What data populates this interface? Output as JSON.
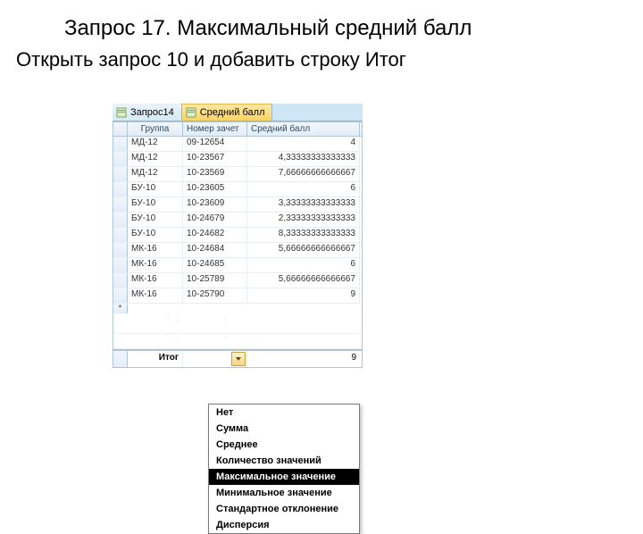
{
  "heading": "Запрос 17. Максимальный средний балл",
  "subheading": "Открыть запрос 10 и добавить строку Итог",
  "tabs": {
    "items": [
      {
        "label": "Запрос14",
        "icon": "query-icon"
      },
      {
        "label": "Средний балл",
        "icon": "query-icon"
      }
    ],
    "active_index": 1
  },
  "grid": {
    "columns": {
      "group": "Группа",
      "record_no": "Номер зачет",
      "avg": "Средний балл"
    },
    "rows": [
      {
        "group": "МД-12",
        "record_no": "09-12654",
        "avg": "4"
      },
      {
        "group": "МД-12",
        "record_no": "10-23567",
        "avg": "4,33333333333333"
      },
      {
        "group": "МД-12",
        "record_no": "10-23569",
        "avg": "7,66666666666667"
      },
      {
        "group": "БУ-10",
        "record_no": "10-23605",
        "avg": "6"
      },
      {
        "group": "БУ-10",
        "record_no": "10-23609",
        "avg": "3,33333333333333"
      },
      {
        "group": "БУ-10",
        "record_no": "10-24679",
        "avg": "2,33333333333333"
      },
      {
        "group": "БУ-10",
        "record_no": "10-24682",
        "avg": "8,33333333333333"
      },
      {
        "group": "МК-16",
        "record_no": "10-24684",
        "avg": "5,66666666666667"
      },
      {
        "group": "МК-16",
        "record_no": "10-24685",
        "avg": "6"
      },
      {
        "group": "МК-16",
        "record_no": "10-25789",
        "avg": "5,66666666666667"
      },
      {
        "group": "МК-16",
        "record_no": "10-25790",
        "avg": "9"
      }
    ],
    "totals": {
      "label": "Итог",
      "avg_value": "9"
    }
  },
  "dropdown": {
    "options": [
      "Нет",
      "Сумма",
      "Среднее",
      "Количество значений",
      "Максимальное значение",
      "Минимальное значение",
      "Стандартное отклонение",
      "Дисперсия"
    ],
    "selected_index": 4
  }
}
